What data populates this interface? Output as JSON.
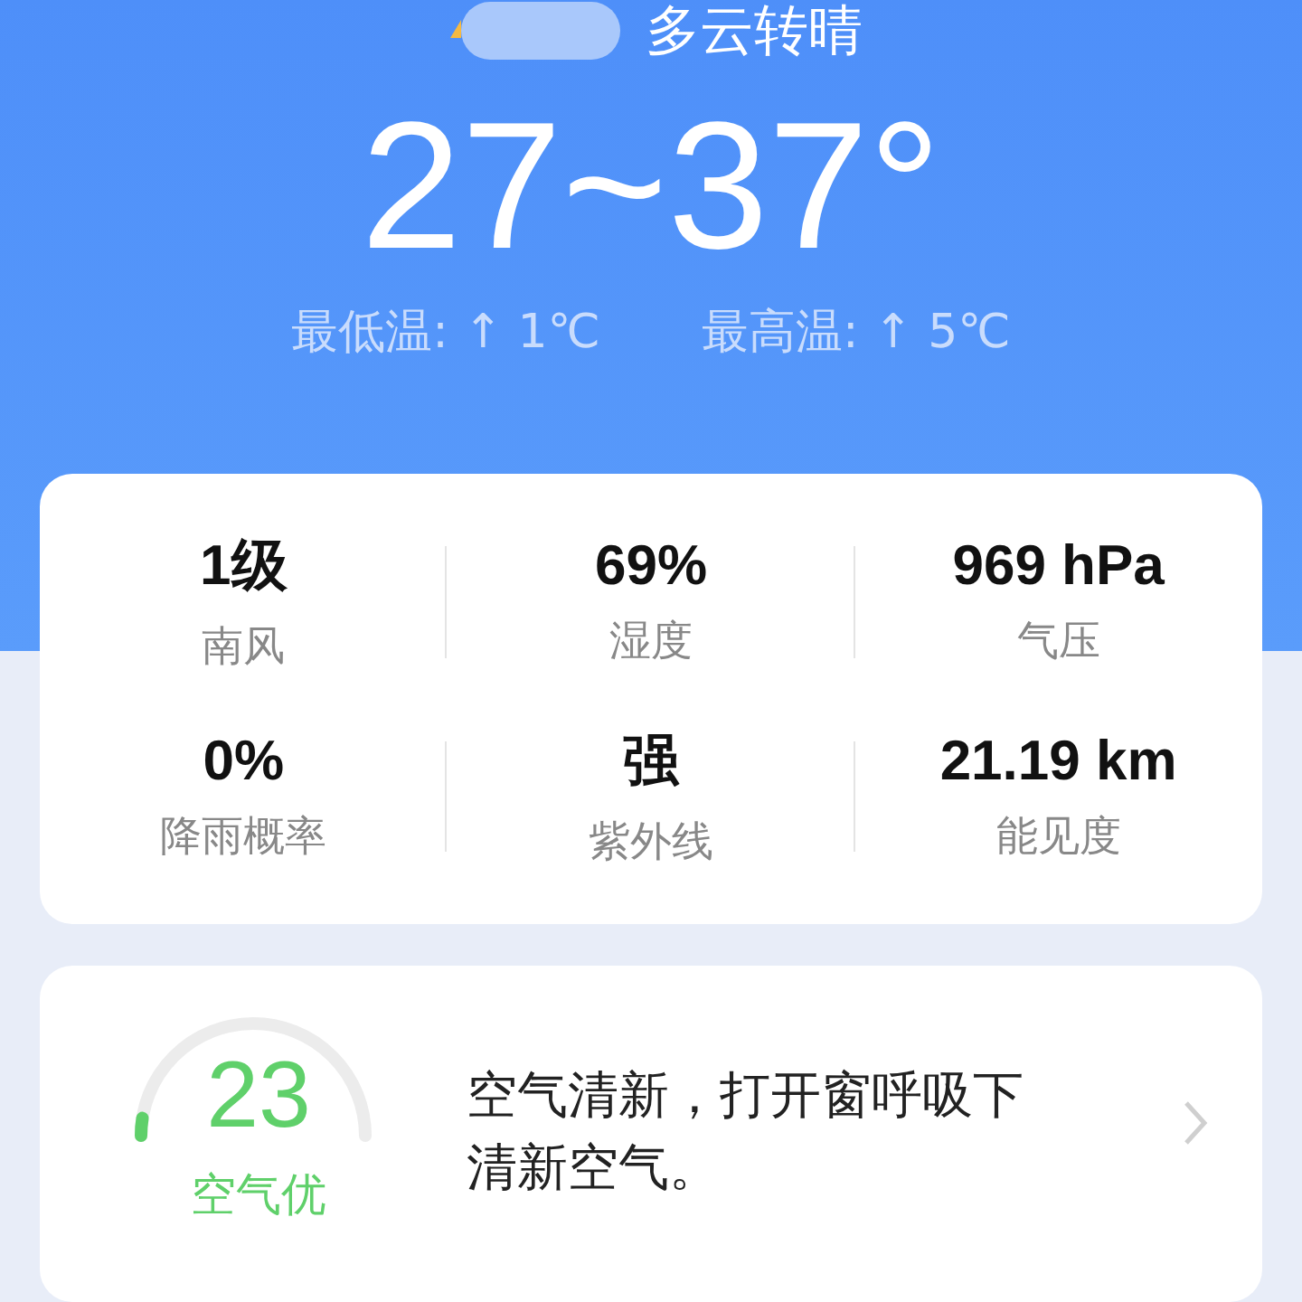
{
  "weather": {
    "condition": "多云转晴",
    "temperature": "27~37°",
    "min_temp": "最低温: ↑ 1℃",
    "max_temp": "最高温: ↑ 5℃"
  },
  "details": [
    {
      "value": "1级",
      "label": "南风"
    },
    {
      "value": "69%",
      "label": "湿度"
    },
    {
      "value": "969 hPa",
      "label": "气压"
    },
    {
      "value": "0%",
      "label": "降雨概率"
    },
    {
      "value": "强",
      "label": "紫外线"
    },
    {
      "value": "21.19 km",
      "label": "能见度"
    }
  ],
  "air_quality": {
    "aqi": "23",
    "grade": "空气优",
    "advice": "空气清新，打开窗呼吸下清新空气。"
  }
}
